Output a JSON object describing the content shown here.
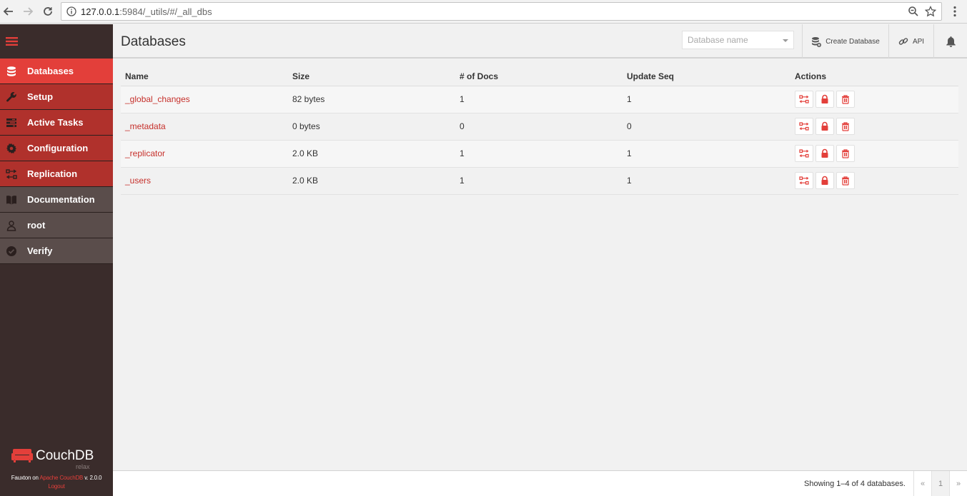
{
  "browser": {
    "url_host": "127.0.0.1",
    "url_path": ":5984/_utils/#/_all_dbs"
  },
  "sidebar": {
    "items": [
      {
        "label": "Databases",
        "icon": "database-icon"
      },
      {
        "label": "Setup",
        "icon": "wrench-icon"
      },
      {
        "label": "Active Tasks",
        "icon": "tasks-icon"
      },
      {
        "label": "Configuration",
        "icon": "gear-icon"
      },
      {
        "label": "Replication",
        "icon": "replication-icon"
      },
      {
        "label": "Documentation",
        "icon": "book-icon"
      },
      {
        "label": "root",
        "icon": "user-icon"
      },
      {
        "label": "Verify",
        "icon": "check-circle-icon"
      }
    ],
    "logo_text": "CouchDB",
    "logo_tag": "relax",
    "footer": {
      "prefix": "Fauxton on",
      "link": "Apache CouchDB",
      "version": "v. 2.0.0",
      "logout": "Logout"
    }
  },
  "header": {
    "title": "Databases",
    "search_placeholder": "Database name",
    "create_label": "Create Database",
    "api_label": "API"
  },
  "table": {
    "columns": [
      "Name",
      "Size",
      "# of Docs",
      "Update Seq",
      "Actions"
    ],
    "rows": [
      {
        "name": "_global_changes",
        "size": "82 bytes",
        "docs": "1",
        "seq": "1"
      },
      {
        "name": "_metadata",
        "size": "0 bytes",
        "docs": "0",
        "seq": "0"
      },
      {
        "name": "_replicator",
        "size": "2.0 KB",
        "docs": "1",
        "seq": "1"
      },
      {
        "name": "_users",
        "size": "2.0 KB",
        "docs": "1",
        "seq": "1"
      }
    ]
  },
  "footer_bar": {
    "showing": "Showing 1–4 of 4 databases.",
    "prev": "«",
    "page": "1",
    "next": "»"
  },
  "colors": {
    "accent": "#e33f3a",
    "sidebar": "#3a2c2b",
    "nav_red": "#b0312c",
    "nav_grey": "#5a4d4b"
  }
}
